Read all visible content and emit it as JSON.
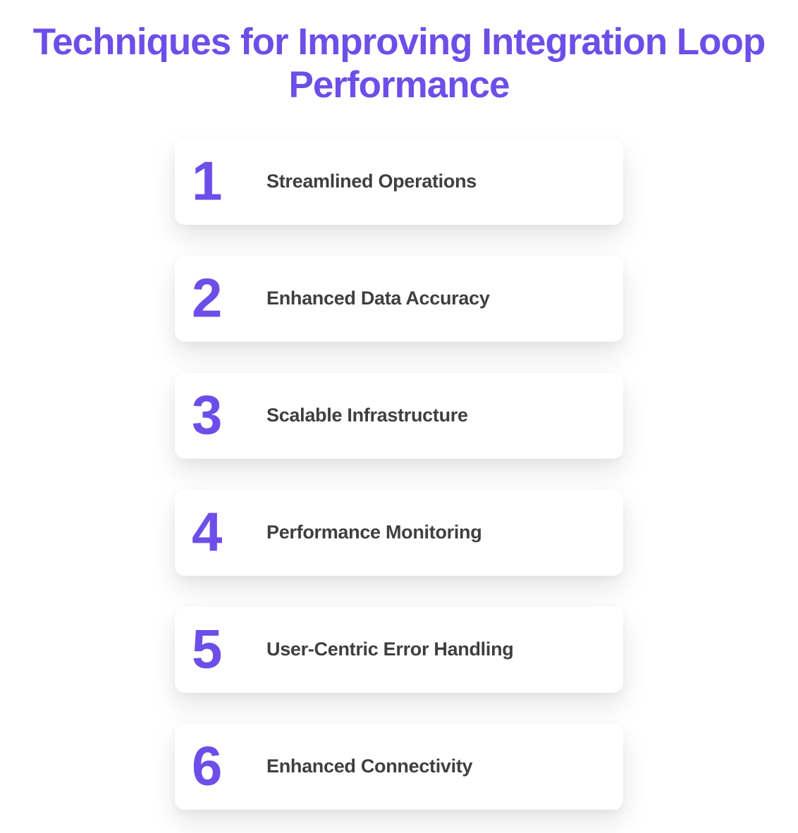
{
  "title": "Techniques for Improving Integration Loop Performance",
  "items": [
    {
      "num": "1",
      "label": "Streamlined Operations"
    },
    {
      "num": "2",
      "label": "Enhanced Data Accuracy"
    },
    {
      "num": "3",
      "label": "Scalable Infrastructure"
    },
    {
      "num": "4",
      "label": "Performance Monitoring"
    },
    {
      "num": "5",
      "label": "User-Centric Error Handling"
    },
    {
      "num": "6",
      "label": "Enhanced Connectivity"
    }
  ],
  "colors": {
    "accent": "#6d4ee8",
    "text": "#3f3f3f",
    "card_bg": "#ffffff"
  }
}
